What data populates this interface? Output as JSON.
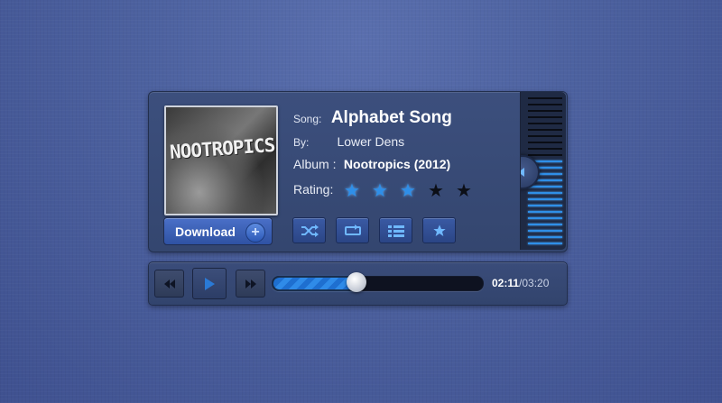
{
  "album_art": {
    "text": "NOOTROPICS"
  },
  "download": {
    "label": "Download",
    "icon": "plus-icon"
  },
  "track_info": {
    "song_label": "Song:",
    "song": "Alphabet Song",
    "by_label": "By:",
    "artist": "Lower Dens",
    "album_label": "Album :",
    "album": "Nootropics (2012)",
    "rating_label": "Rating:",
    "rating": 3,
    "rating_max": 5
  },
  "controls": [
    {
      "name": "shuffle-button",
      "icon": "shuffle-icon"
    },
    {
      "name": "repeat-button",
      "icon": "repeat-icon"
    },
    {
      "name": "playlist-button",
      "icon": "list-icon"
    },
    {
      "name": "favorite-button",
      "icon": "star-icon"
    }
  ],
  "volume": {
    "level": 0.6,
    "icon": "speaker-icon"
  },
  "transport": {
    "rewind_icon": "rewind-icon",
    "play_icon": "play-icon",
    "forward_icon": "fast-forward-icon"
  },
  "progress": {
    "fraction": 0.4,
    "current": "02:11",
    "separator": "/",
    "total": "03:20"
  },
  "colors": {
    "accent": "#2f8fe8",
    "panel": "#3a4c7a",
    "background": "#4d62a0"
  }
}
